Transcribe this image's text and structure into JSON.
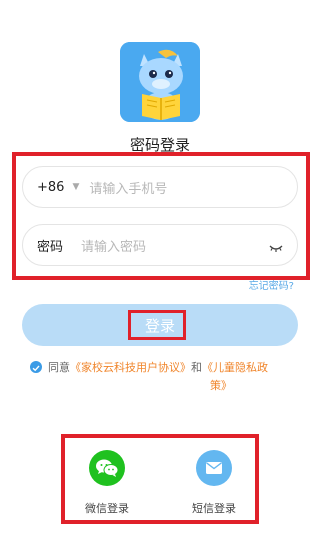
{
  "login": {
    "title": "密码登录",
    "phone_prefix": "+86",
    "phone_placeholder": "请输入手机号",
    "password_label": "密码",
    "password_placeholder": "请输入密码",
    "forgot_password": "忘记密码?",
    "login_button": "登录"
  },
  "agreement": {
    "prefix": "同意",
    "user_agreement": "《家校云科技用户协议》",
    "and": "和",
    "privacy_policy_part1": "《儿童隐私政",
    "privacy_policy_part2": "策》",
    "checked": true
  },
  "social_login": [
    {
      "label": "微信登录",
      "icon": "wechat-icon"
    },
    {
      "label": "短信登录",
      "icon": "sms-mail-icon"
    }
  ],
  "colors": {
    "accent": "#3b9be6",
    "login_button_bg": "#b9dcf7",
    "link_orange": "#f0852b",
    "highlight_red": "#e0212a",
    "wechat_green": "#1fc11f"
  }
}
